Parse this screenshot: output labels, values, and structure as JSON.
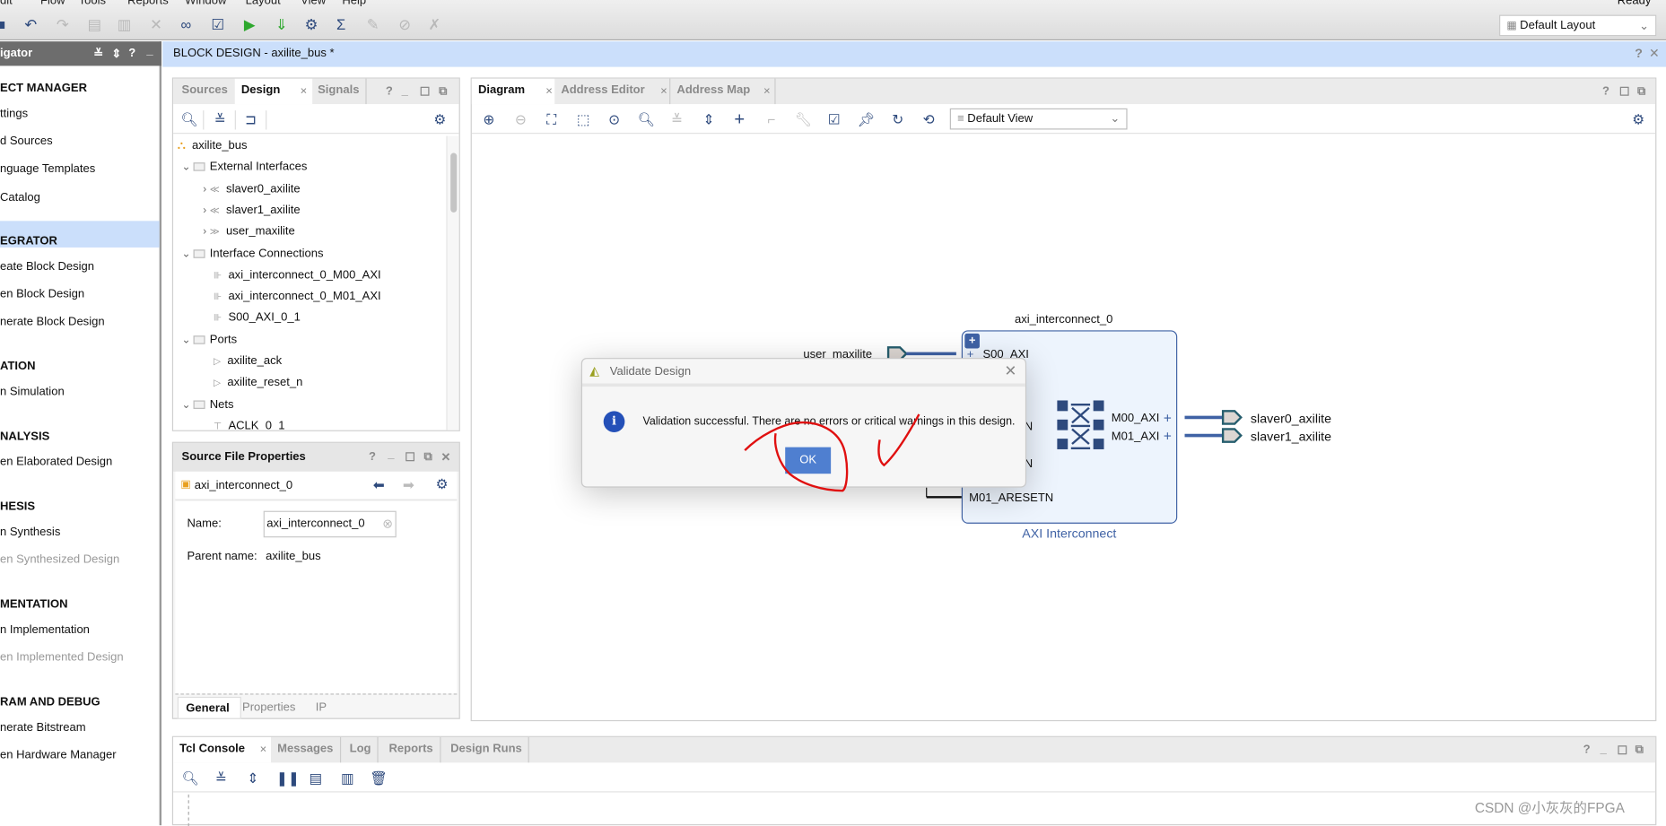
{
  "menu": [
    "dit",
    "Flow",
    "Tools",
    "Reports",
    "Window",
    "Layout",
    "View",
    "Help"
  ],
  "status": "Ready",
  "layout_select": "Default Layout",
  "toolbar_icons": [
    "save-icon",
    "undo-icon",
    "redo-icon",
    "copy-icon",
    "paste-icon",
    "delete-icon",
    "find-icon",
    "validate-icon",
    "run-icon",
    "bitstream-icon",
    "settings-icon",
    "sigma-icon",
    "waive-icon",
    "link-icon",
    "cut-icon"
  ],
  "navigator": {
    "title": "igator",
    "items": [
      {
        "label": "ECT MANAGER",
        "type": "section"
      },
      {
        "label": "ttings"
      },
      {
        "label": "d Sources"
      },
      {
        "label": "nguage Templates"
      },
      {
        "label": "Catalog"
      },
      {
        "label": "EGRATOR",
        "type": "section",
        "selected": true
      },
      {
        "label": "eate Block Design"
      },
      {
        "label": "en Block Design"
      },
      {
        "label": "nerate Block Design"
      },
      {
        "label": "ATION",
        "type": "section"
      },
      {
        "label": "n Simulation"
      },
      {
        "label": "NALYSIS",
        "type": "section"
      },
      {
        "label": "en Elaborated Design"
      },
      {
        "label": "HESIS",
        "type": "section"
      },
      {
        "label": "n Synthesis"
      },
      {
        "label": "en Synthesized Design",
        "disabled": true
      },
      {
        "label": "MENTATION",
        "type": "section"
      },
      {
        "label": "n Implementation"
      },
      {
        "label": "en Implemented Design",
        "disabled": true
      },
      {
        "label": "RAM AND DEBUG",
        "type": "section"
      },
      {
        "label": "nerate Bitstream"
      },
      {
        "label": "en Hardware Manager"
      }
    ]
  },
  "block_design": {
    "prefix": "BLOCK DESIGN",
    "name": " - axilite_bus *"
  },
  "sources_panel": {
    "tabs": [
      "Sources",
      "Design",
      "Signals"
    ],
    "active_tab": "Design",
    "tree": [
      {
        "label": "axilite_bus",
        "level": 0,
        "icon": "hierarchy-icon"
      },
      {
        "label": "External Interfaces",
        "level": 1,
        "icon": "folder-icon",
        "expanded": true
      },
      {
        "label": "slaver0_axilite",
        "level": 2,
        "icon": "interface-in-icon"
      },
      {
        "label": "slaver1_axilite",
        "level": 2,
        "icon": "interface-in-icon"
      },
      {
        "label": "user_maxilite",
        "level": 2,
        "icon": "interface-out-icon"
      },
      {
        "label": "Interface Connections",
        "level": 1,
        "icon": "folder-icon",
        "expanded": true
      },
      {
        "label": "axi_interconnect_0_M00_AXI",
        "level": 3,
        "icon": "connection-icon"
      },
      {
        "label": "axi_interconnect_0_M01_AXI",
        "level": 3,
        "icon": "connection-icon"
      },
      {
        "label": "S00_AXI_0_1",
        "level": 3,
        "icon": "connection-icon"
      },
      {
        "label": "Ports",
        "level": 1,
        "icon": "folder-icon",
        "expanded": true
      },
      {
        "label": "axilite_ack",
        "level": 3,
        "icon": "port-icon"
      },
      {
        "label": "axilite_reset_n",
        "level": 3,
        "icon": "port-icon"
      },
      {
        "label": "Nets",
        "level": 1,
        "icon": "folder-icon",
        "expanded": true
      },
      {
        "label": "ACLK_0_1",
        "level": 3,
        "icon": "net-icon"
      }
    ]
  },
  "properties_panel": {
    "title": "Source File Properties",
    "object": "axi_interconnect_0",
    "name_label": "Name:",
    "name_value": "axi_interconnect_0",
    "parent_label": "Parent name:",
    "parent_value": "axilite_bus",
    "tabs": [
      "General",
      "Properties",
      "IP"
    ]
  },
  "diagram_panel": {
    "tabs": [
      "Diagram",
      "Address Editor",
      "Address Map"
    ],
    "view_select": "Default View"
  },
  "diagram": {
    "block_name": "axi_interconnect_0",
    "block_type": "AXI Interconnect",
    "input_port": "user_maxilite",
    "pins_left": [
      "S00_AXI",
      "ETN",
      "ETN",
      "M01_ARESETN"
    ],
    "pins_right": [
      "M00_AXI",
      "M01_AXI"
    ],
    "outputs": [
      "slaver0_axilite",
      "slaver1_axilite"
    ]
  },
  "dialog": {
    "title": "Validate Design",
    "message": "Validation successful. There are no errors or critical warnings in this design.",
    "ok": "OK"
  },
  "console": {
    "tabs": [
      "Tcl Console",
      "Messages",
      "Log",
      "Reports",
      "Design Runs"
    ],
    "active_tab": "Tcl Console"
  },
  "watermark": "CSDN @小灰灰的FPGA",
  "colors": {
    "accent": "#2e4a7d",
    "header_blue": "#cbdffb",
    "ok_button": "#4f7fd0",
    "annotation": "#e01010"
  }
}
